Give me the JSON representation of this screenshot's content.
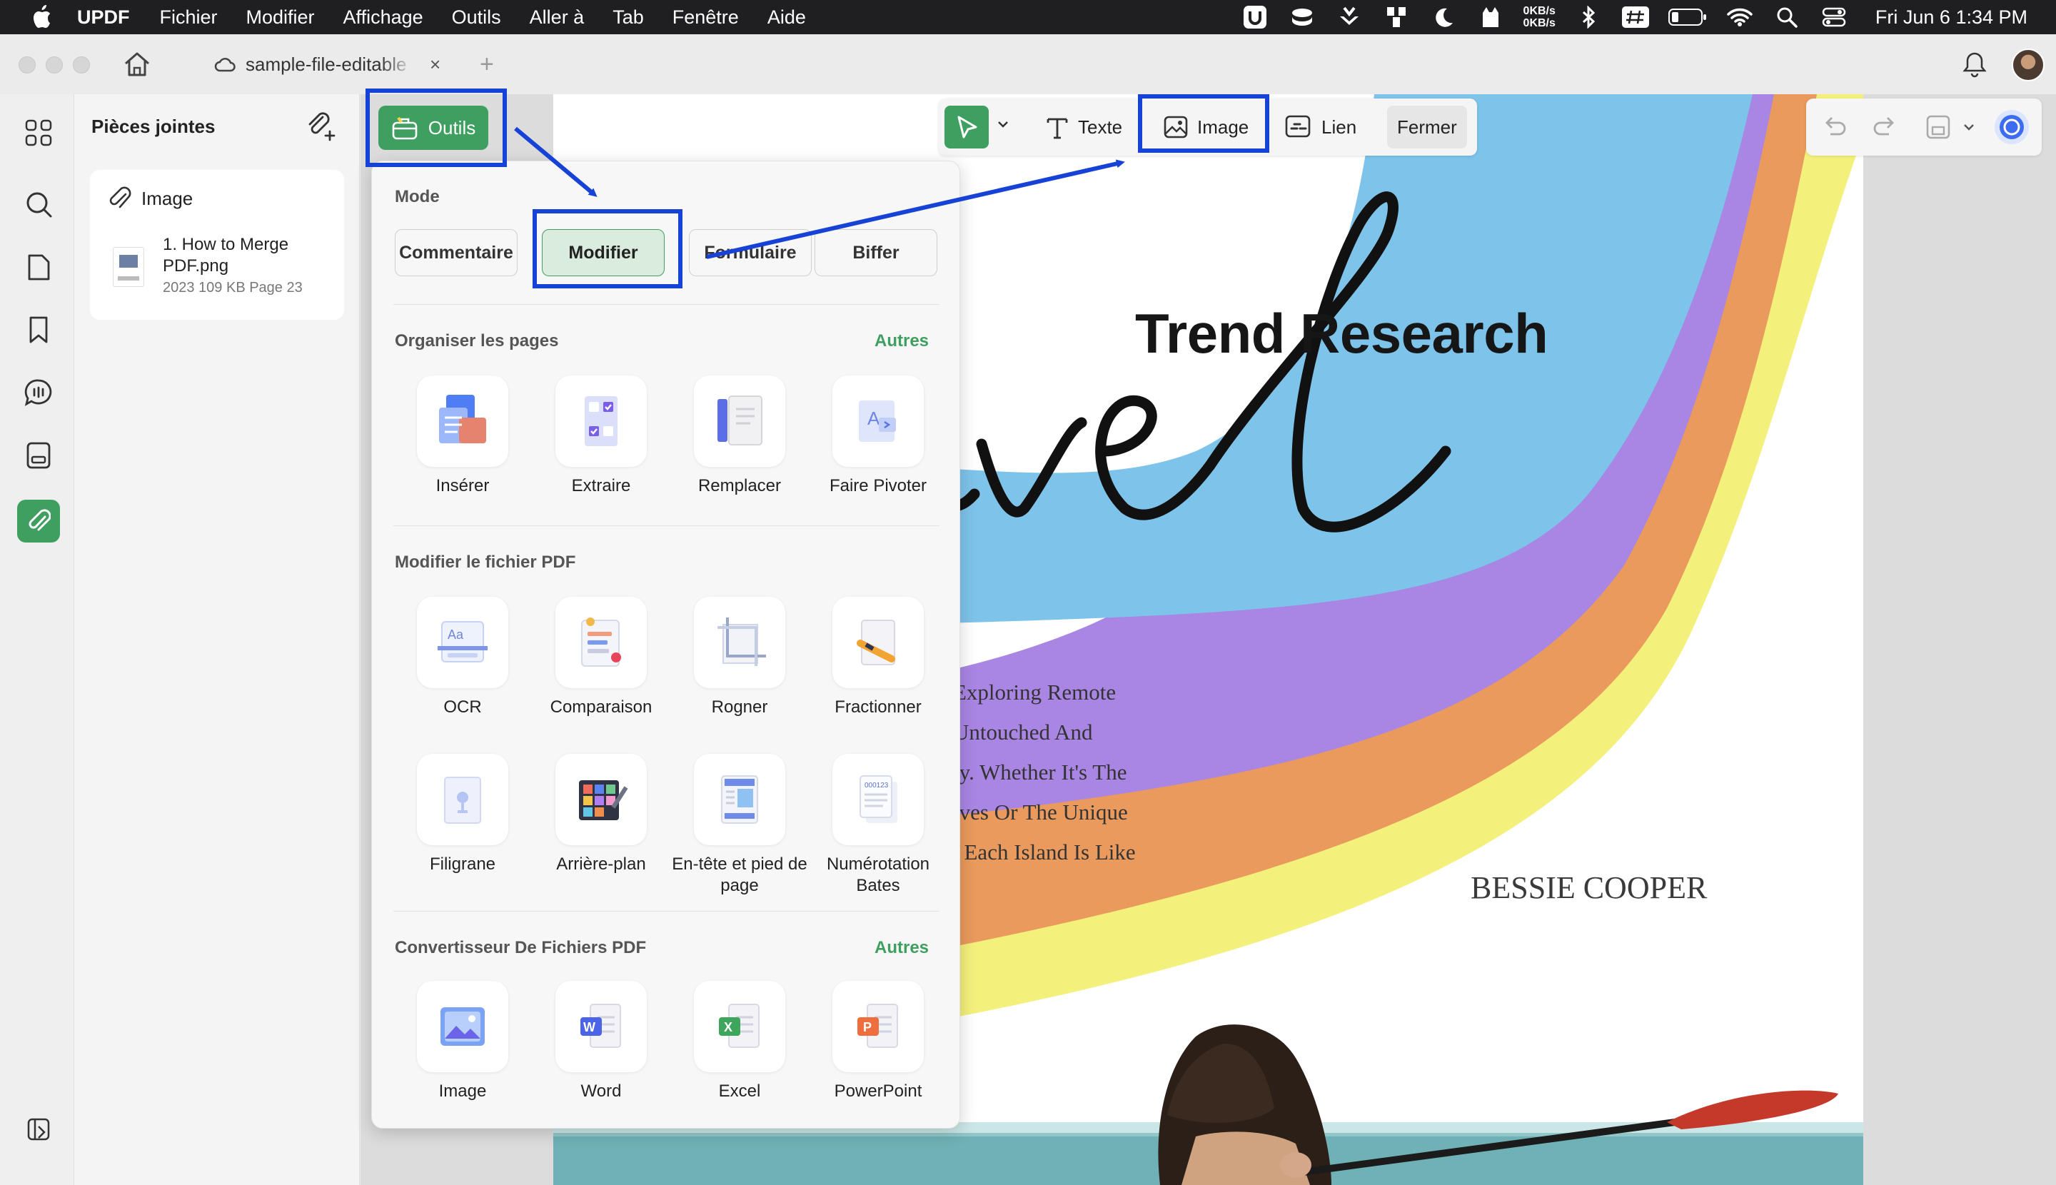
{
  "menubar": {
    "app_name": "UPDF",
    "items": [
      "Fichier",
      "Modifier",
      "Affichage",
      "Outils",
      "Aller à",
      "Tab",
      "Fenêtre",
      "Aide"
    ],
    "net_up": "0KB/s",
    "net_down": "0KB/s",
    "clock": "Fri Jun 6  1:34 PM"
  },
  "tab": {
    "title": "sample-file-editable",
    "close": "×",
    "new": "+"
  },
  "attachments": {
    "title": "Pièces jointes",
    "card": {
      "header": "Image",
      "filename": "1. How to Merge PDF.png",
      "meta": "2023  109 KB  Page 23"
    }
  },
  "toolbar": {
    "outils_label": "Outils",
    "texte_label": "Texte",
    "image_label": "Image",
    "lien_label": "Lien",
    "fermer_label": "Fermer"
  },
  "tools_panel": {
    "mode_label": "Mode",
    "modes": [
      "Commentaire",
      "Modifier",
      "Formulaire",
      "Biffer"
    ],
    "organize": {
      "label": "Organiser les pages",
      "more": "Autres",
      "tools": [
        "Insérer",
        "Extraire",
        "Remplacer",
        "Faire Pivoter"
      ]
    },
    "modify": {
      "label": "Modifier le fichier PDF",
      "tools": [
        "OCR",
        "Comparaison",
        "Rogner",
        "Fractionner",
        "Filigrane",
        "Arrière-plan",
        "En-tête et pied de page",
        "Numérotation Bates"
      ]
    },
    "convert": {
      "label": "Convertisseur De Fichiers PDF",
      "more": "Autres",
      "tools": [
        "Image",
        "Word",
        "Excel",
        "PowerPoint"
      ]
    }
  },
  "document": {
    "title": "Trend Research",
    "script_word": "Travel",
    "body_lines": [
      "Exploring Remote",
      "Untouched And",
      "ty. Whether It's The",
      "ives Or The Unique",
      ", Each Island Is Like"
    ],
    "author": "BESSIE COOPER"
  },
  "colors": {
    "accent": "#3f9f60",
    "annotation": "#1742d6",
    "rainbow": [
      "#7ec3ea",
      "#a985e4",
      "#e99a5c",
      "#f3f07c"
    ]
  }
}
